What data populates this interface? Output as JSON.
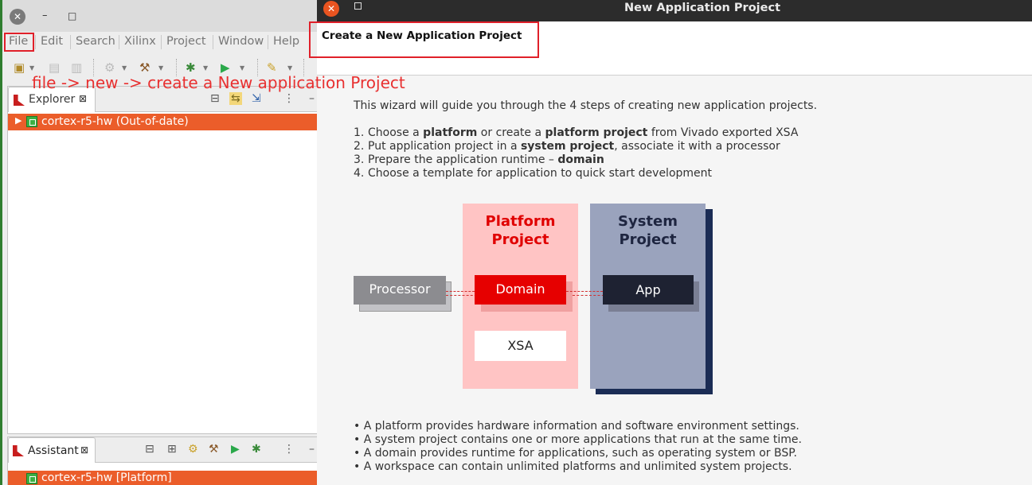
{
  "ide": {
    "window_controls": {
      "close": "✕",
      "minimize": "–",
      "maximize": "□"
    },
    "menu": [
      "File",
      "Edit",
      "Search",
      "Xilinx",
      "Project",
      "Window",
      "Help"
    ],
    "explorer": {
      "tab_label": "Explorer",
      "tree_item": "cortex-r5-hw (Out-of-date)"
    },
    "assistant": {
      "tab_label": "Assistant",
      "tree_item": "cortex-r5-hw [Platform]"
    }
  },
  "annotation": "file -> new -> create a New application Project",
  "dialog": {
    "title": "New Application Project",
    "heading": "Create a New Application Project",
    "intro": "This wizard will guide you through the 4 steps of creating new application projects.",
    "steps": [
      {
        "num": "1.",
        "parts": [
          "Choose a ",
          "platform",
          " or create a ",
          "platform project",
          " from Vivado exported XSA"
        ]
      },
      {
        "num": "2.",
        "parts": [
          "Put application project in a ",
          "system project",
          ", associate it with a processor"
        ]
      },
      {
        "num": "3.",
        "parts": [
          "Prepare the application runtime – ",
          "domain"
        ]
      },
      {
        "num": "4.",
        "parts": [
          "Choose a template for application to quick start development"
        ]
      }
    ],
    "diagram": {
      "platform_project": [
        "Platform",
        "Project"
      ],
      "system_project": [
        "System",
        "Project"
      ],
      "processor": "Processor",
      "domain": "Domain",
      "app": "App",
      "xsa": "XSA"
    },
    "bullets": [
      "• A platform provides hardware information and software environment settings.",
      "• A system project contains one or more applications that run at the same time.",
      "• A domain provides runtime for applications, such as operating system or BSP.",
      "• A workspace can contain unlimited platforms and unlimited system projects."
    ]
  },
  "colors": {
    "accent_orange": "#eb5d2a",
    "annotation_red": "#e83030",
    "platform_pink": "#ffc4c4",
    "domain_red": "#e60000",
    "system_blue_gray": "#9aa3bd",
    "app_navy": "#1e2232"
  }
}
